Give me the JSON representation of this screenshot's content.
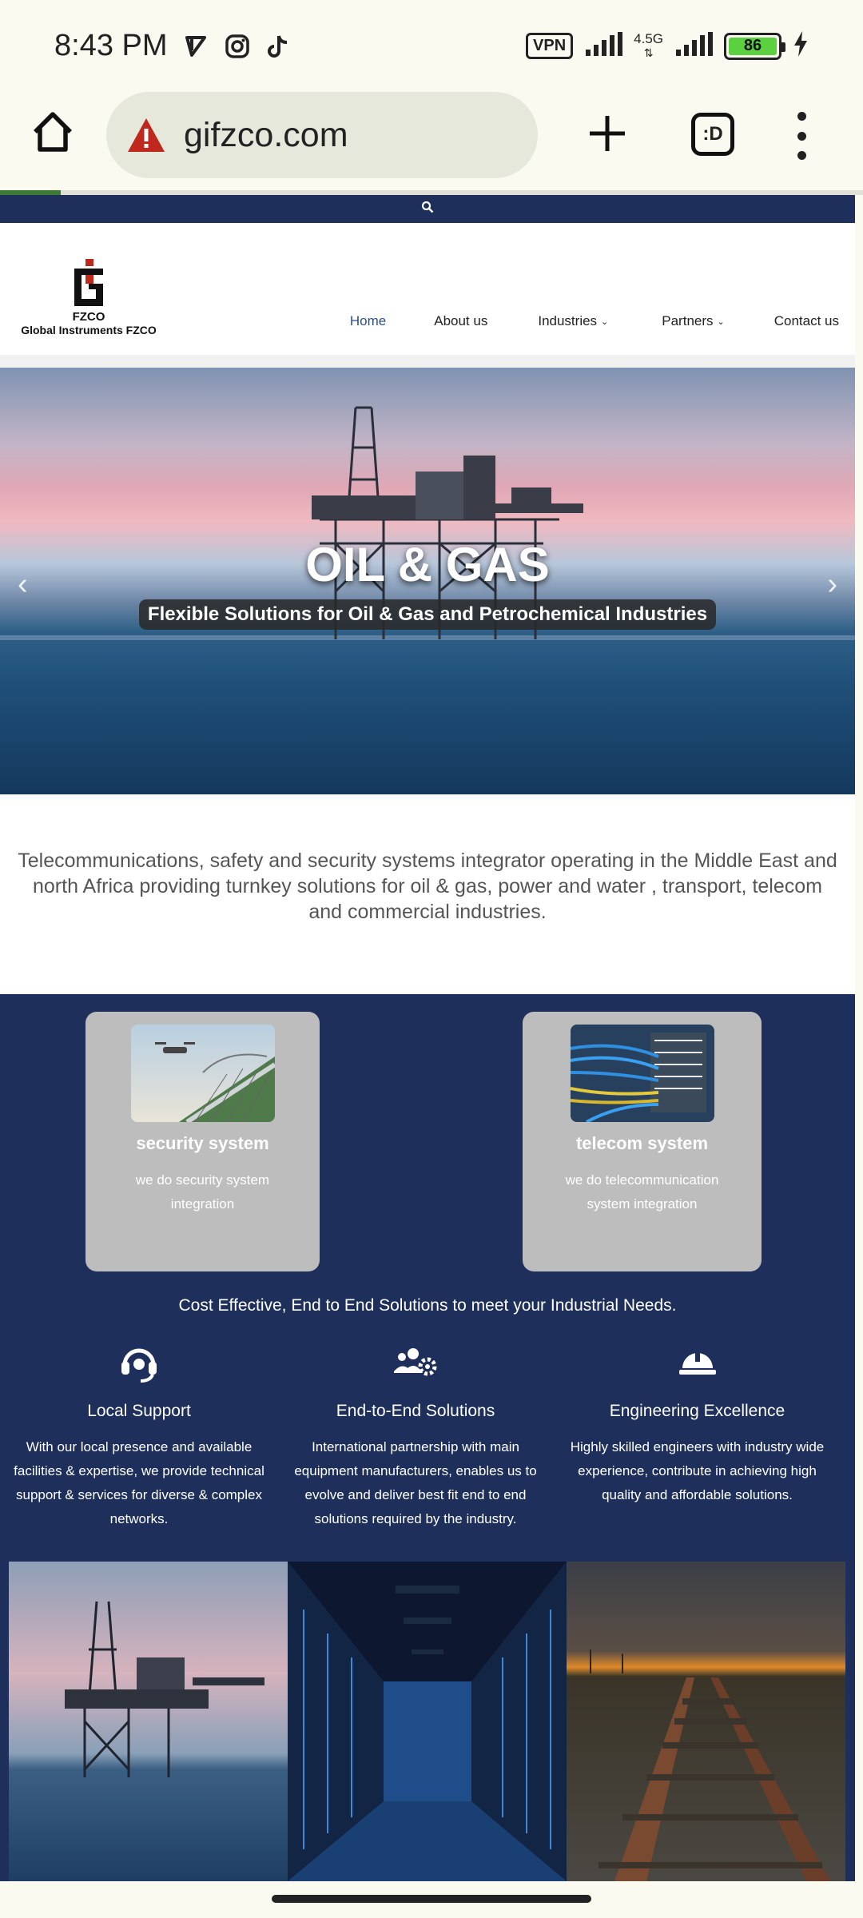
{
  "status_bar": {
    "time": "8:43 PM",
    "vpn": "VPN",
    "network": "4.5G",
    "battery": "86"
  },
  "browser": {
    "url": "gifzco.com",
    "tabs_label": ":D",
    "load_progress_pct": 7
  },
  "site": {
    "logo": {
      "mark": "FZCO",
      "name": "Global Instruments FZCO"
    },
    "nav": [
      {
        "label": "Home",
        "active": true
      },
      {
        "label": "About us"
      },
      {
        "label": "Industries",
        "has_dropdown": true
      },
      {
        "label": "Partners",
        "has_dropdown": true
      },
      {
        "label": "Contact us"
      }
    ],
    "hero": {
      "title": "OIL & GAS",
      "subtitle": "Flexible Solutions for Oil & Gas and Petrochemical Industries"
    },
    "intro": "Telecommunications, safety and security systems integrator operating in the Middle East and north Africa providing turnkey solutions for oil & gas, power and water , transport, telecom and commercial industries.",
    "cards": [
      {
        "title": "security system",
        "desc": "we do security system integration"
      },
      {
        "title": "telecom system",
        "desc": "we do telecommunication system integration"
      }
    ],
    "tagline": "Cost Effective, End to End Solutions to meet your Industrial Needs.",
    "features": [
      {
        "title": "Local Support",
        "desc": "With our local presence and available facilities & expertise, we provide technical support & services for diverse & complex networks."
      },
      {
        "title": "End-to-End Solutions",
        "desc": "International partnership with main equipment manufacturers, enables us to evolve and deliver best fit end to end solutions required by the industry."
      },
      {
        "title": "Engineering Excellence",
        "desc": "Highly skilled engineers with industry wide experience, contribute in achieving high quality and affordable solutions."
      }
    ],
    "colors": {
      "navy": "#1d2f5a",
      "card_gray": "#bdbdbd",
      "nav_active": "#2a4f8f"
    }
  }
}
